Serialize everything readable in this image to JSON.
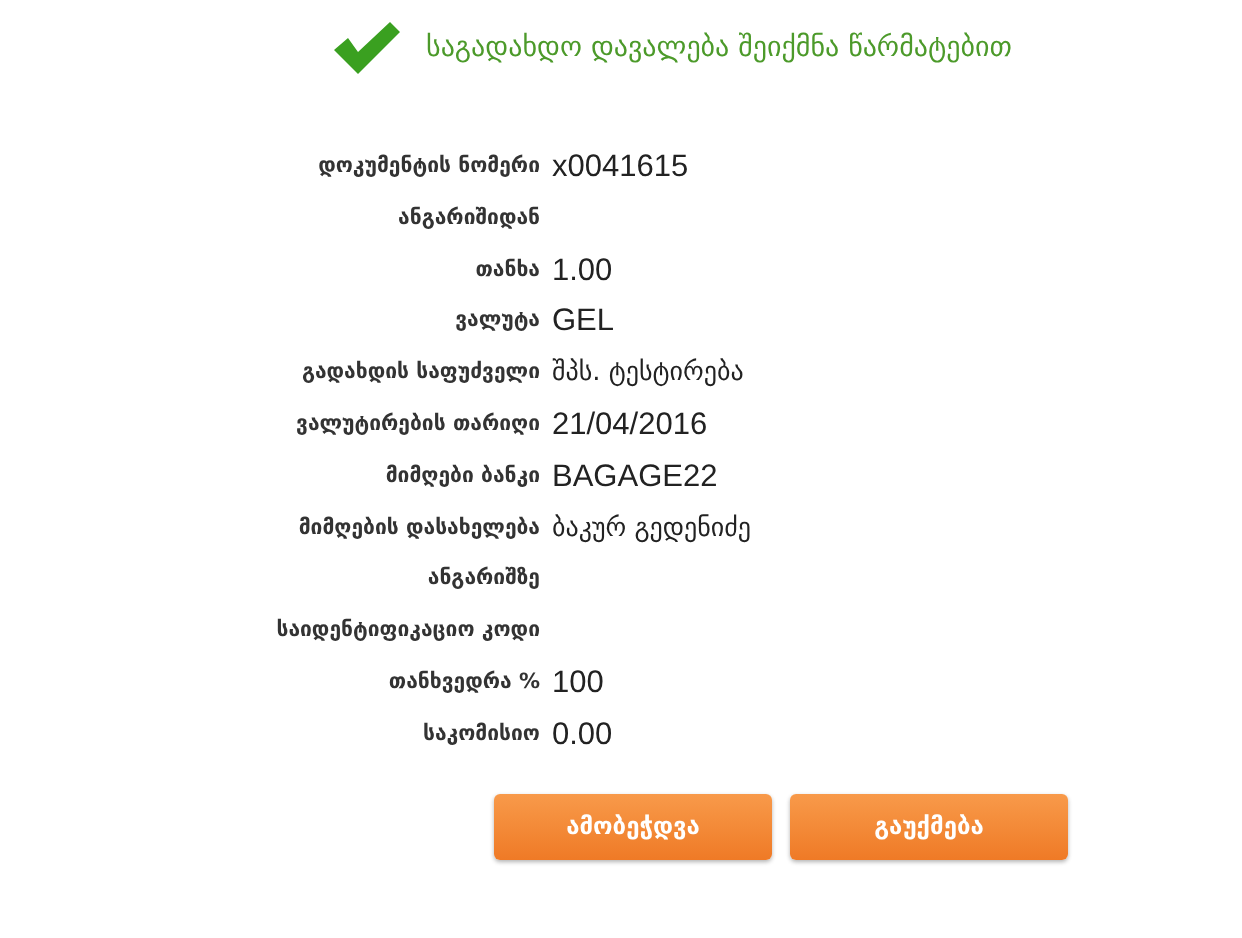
{
  "message": {
    "text": "საგადახდო დავალება შეიქმნა წარმატებით"
  },
  "fields": [
    {
      "label": "დოკუმენტის ნომერი",
      "value": "x0041615"
    },
    {
      "label": "ანგარიშიდან"
    },
    {
      "label": "თანხა",
      "value": "1.00"
    },
    {
      "label": "ვალუტა",
      "value": "GEL"
    },
    {
      "label": "გადახდის საფუძველი",
      "value": "შპს. ტესტირება"
    },
    {
      "label": "ვალუტირების თარიღი",
      "value": "21/04/2016"
    },
    {
      "label": "მიმღები ბანკი",
      "value": "BAGAGE22"
    },
    {
      "label": "მიმღების დასახელება",
      "value": "ბაკურ გედენიძე"
    },
    {
      "label": "ანგარიშზე"
    },
    {
      "label": "საიდენტიფიკაციო კოდი"
    },
    {
      "label": "თანხვედრა %",
      "value": "100"
    },
    {
      "label": "საკომისიო",
      "value": "0.00"
    }
  ],
  "buttons": [
    "ამობეჭდვა",
    "გაუქმება"
  ]
}
